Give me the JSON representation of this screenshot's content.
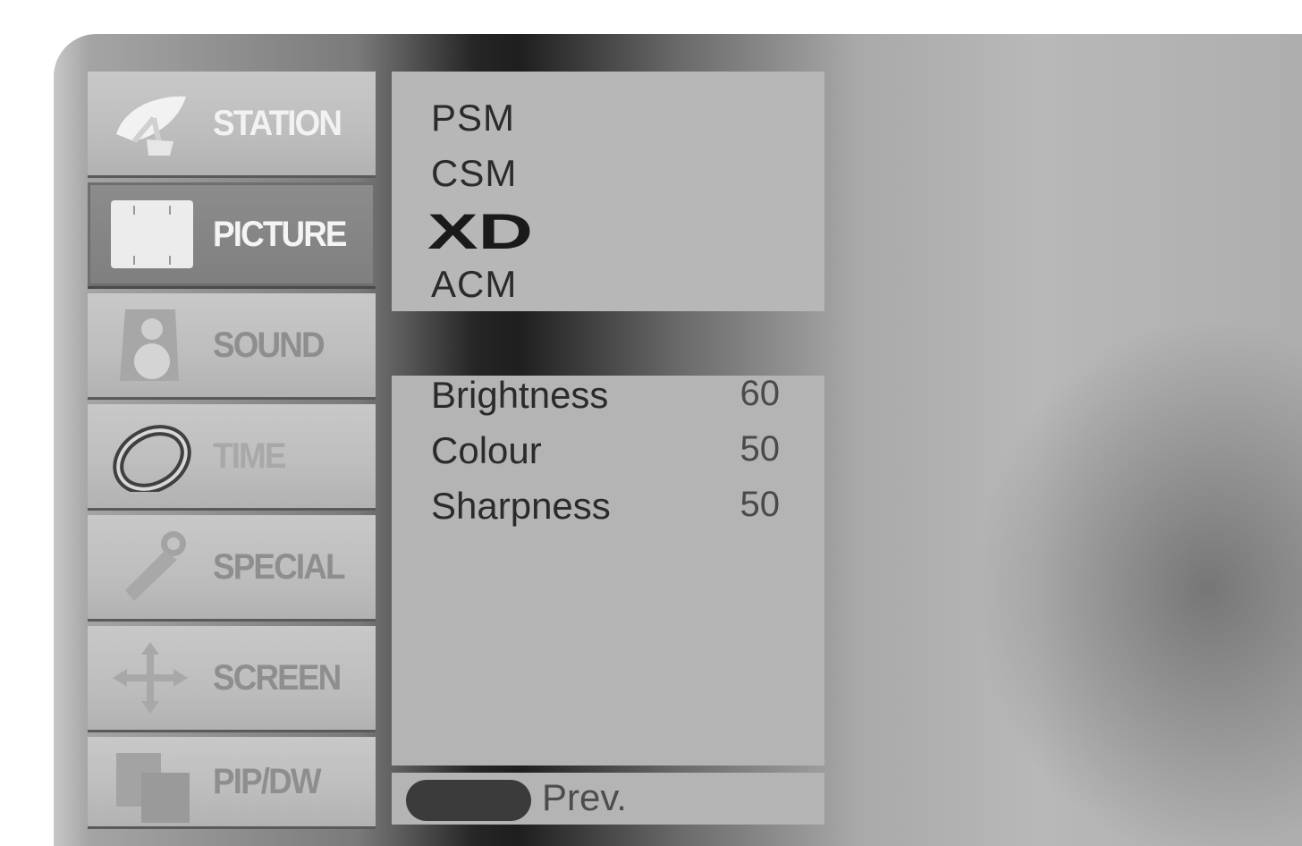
{
  "sidebar": {
    "items": [
      {
        "label": "STATION",
        "icon": "satellite-dish-icon"
      },
      {
        "label": "PICTURE",
        "icon": "tv-screen-icon"
      },
      {
        "label": "SOUND",
        "icon": "speaker-icon"
      },
      {
        "label": "TIME",
        "icon": "clock-ring-icon"
      },
      {
        "label": "SPECIAL",
        "icon": "key-icon"
      },
      {
        "label": "SCREEN",
        "icon": "move-arrows-icon"
      },
      {
        "label": "PIP/DW",
        "icon": "pip-windows-icon"
      }
    ],
    "active_index": 1
  },
  "picture_menu": {
    "options": [
      "PSM",
      "CSM",
      "XD",
      "ACM"
    ]
  },
  "adjustments": {
    "rows": [
      {
        "name": "Brightness",
        "value": "60"
      },
      {
        "name": "Colour",
        "value": "50"
      },
      {
        "name": "Sharpness",
        "value": "50"
      }
    ]
  },
  "footer": {
    "prev_label": "Prev."
  },
  "colors": {
    "panel": "#b6b6b6",
    "active_item": "#808080",
    "text": "#2b2b2b"
  }
}
